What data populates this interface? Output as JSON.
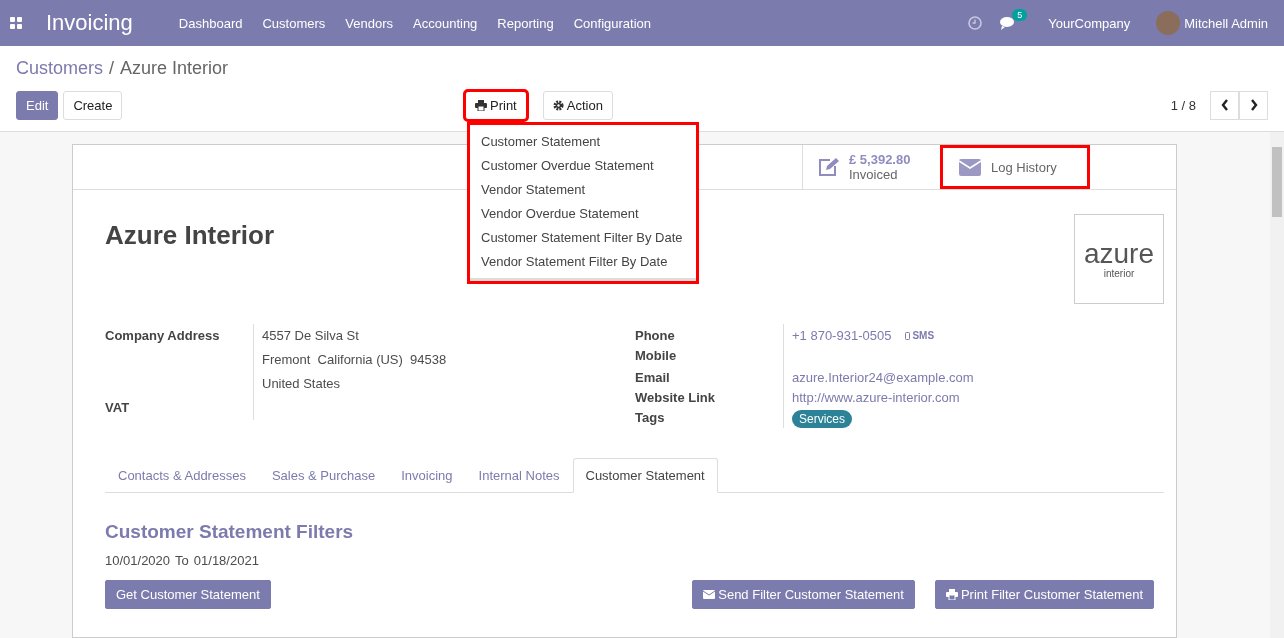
{
  "app": {
    "title": "Invoicing"
  },
  "menu": [
    "Dashboard",
    "Customers",
    "Vendors",
    "Accounting",
    "Reporting",
    "Configuration"
  ],
  "systray": {
    "message_count": "5",
    "company": "YourCompany",
    "user": "Mitchell Admin"
  },
  "breadcrumb": {
    "parent": "Customers",
    "separator": "/",
    "current": "Azure Interior"
  },
  "buttons": [
    "Edit",
    "Create"
  ],
  "print": {
    "label": "Print",
    "highlighted": true
  },
  "action": {
    "label": "Action"
  },
  "print_menu": {
    "highlighted": true,
    "items": [
      "Customer Statement",
      "Customer Overdue Statement",
      "Vendor Statement",
      "Vendor Overdue Statement",
      "Customer Statement Filter By Date",
      "Vendor Statement Filter By Date"
    ]
  },
  "pager": "1 / 8",
  "stat_buttons": [
    {
      "kind": "invoiced",
      "value": "£ 5,392.80",
      "label": "Invoiced",
      "highlighted": false
    },
    {
      "kind": "log",
      "label": "Log History",
      "highlighted": true
    }
  ],
  "partner": {
    "name": "Azure Interior",
    "logo": {
      "word": "azure",
      "sub": "interior"
    }
  },
  "address": {
    "label": "Company Address",
    "lines": [
      "4557 De Silva St",
      "Fremont  California (US)  94538",
      "United States"
    ]
  },
  "vat": {
    "label": "VAT"
  },
  "contact_fields": [
    {
      "kind": "phone",
      "label": "Phone",
      "value": "+1 870-931-0505",
      "action": "SMS"
    },
    {
      "kind": "plain",
      "label": "Mobile"
    },
    {
      "kind": "link",
      "label": "Email",
      "value": "azure.Interior24@example.com"
    },
    {
      "kind": "link",
      "label": "Website Link",
      "value": "http://www.azure-interior.com"
    },
    {
      "kind": "tags",
      "label": "Tags",
      "tags": [
        {
          "text": "Services",
          "color": "#2c8397"
        }
      ]
    }
  ],
  "tabs": [
    {
      "label": "Contacts & Addresses",
      "selected": false
    },
    {
      "label": "Sales & Purchase",
      "selected": false
    },
    {
      "label": "Invoicing",
      "selected": false
    },
    {
      "label": "Internal Notes",
      "selected": false
    },
    {
      "label": "Customer Statement",
      "selected": true
    }
  ],
  "filters": {
    "title": "Customer Statement Filters",
    "date_from": "10/01/2020",
    "to": "To",
    "date_to": "01/18/2021",
    "get_button": "Get Customer Statement",
    "send_button": "Send Filter Customer Statement",
    "print_button": "Print Filter Customer Statement"
  }
}
